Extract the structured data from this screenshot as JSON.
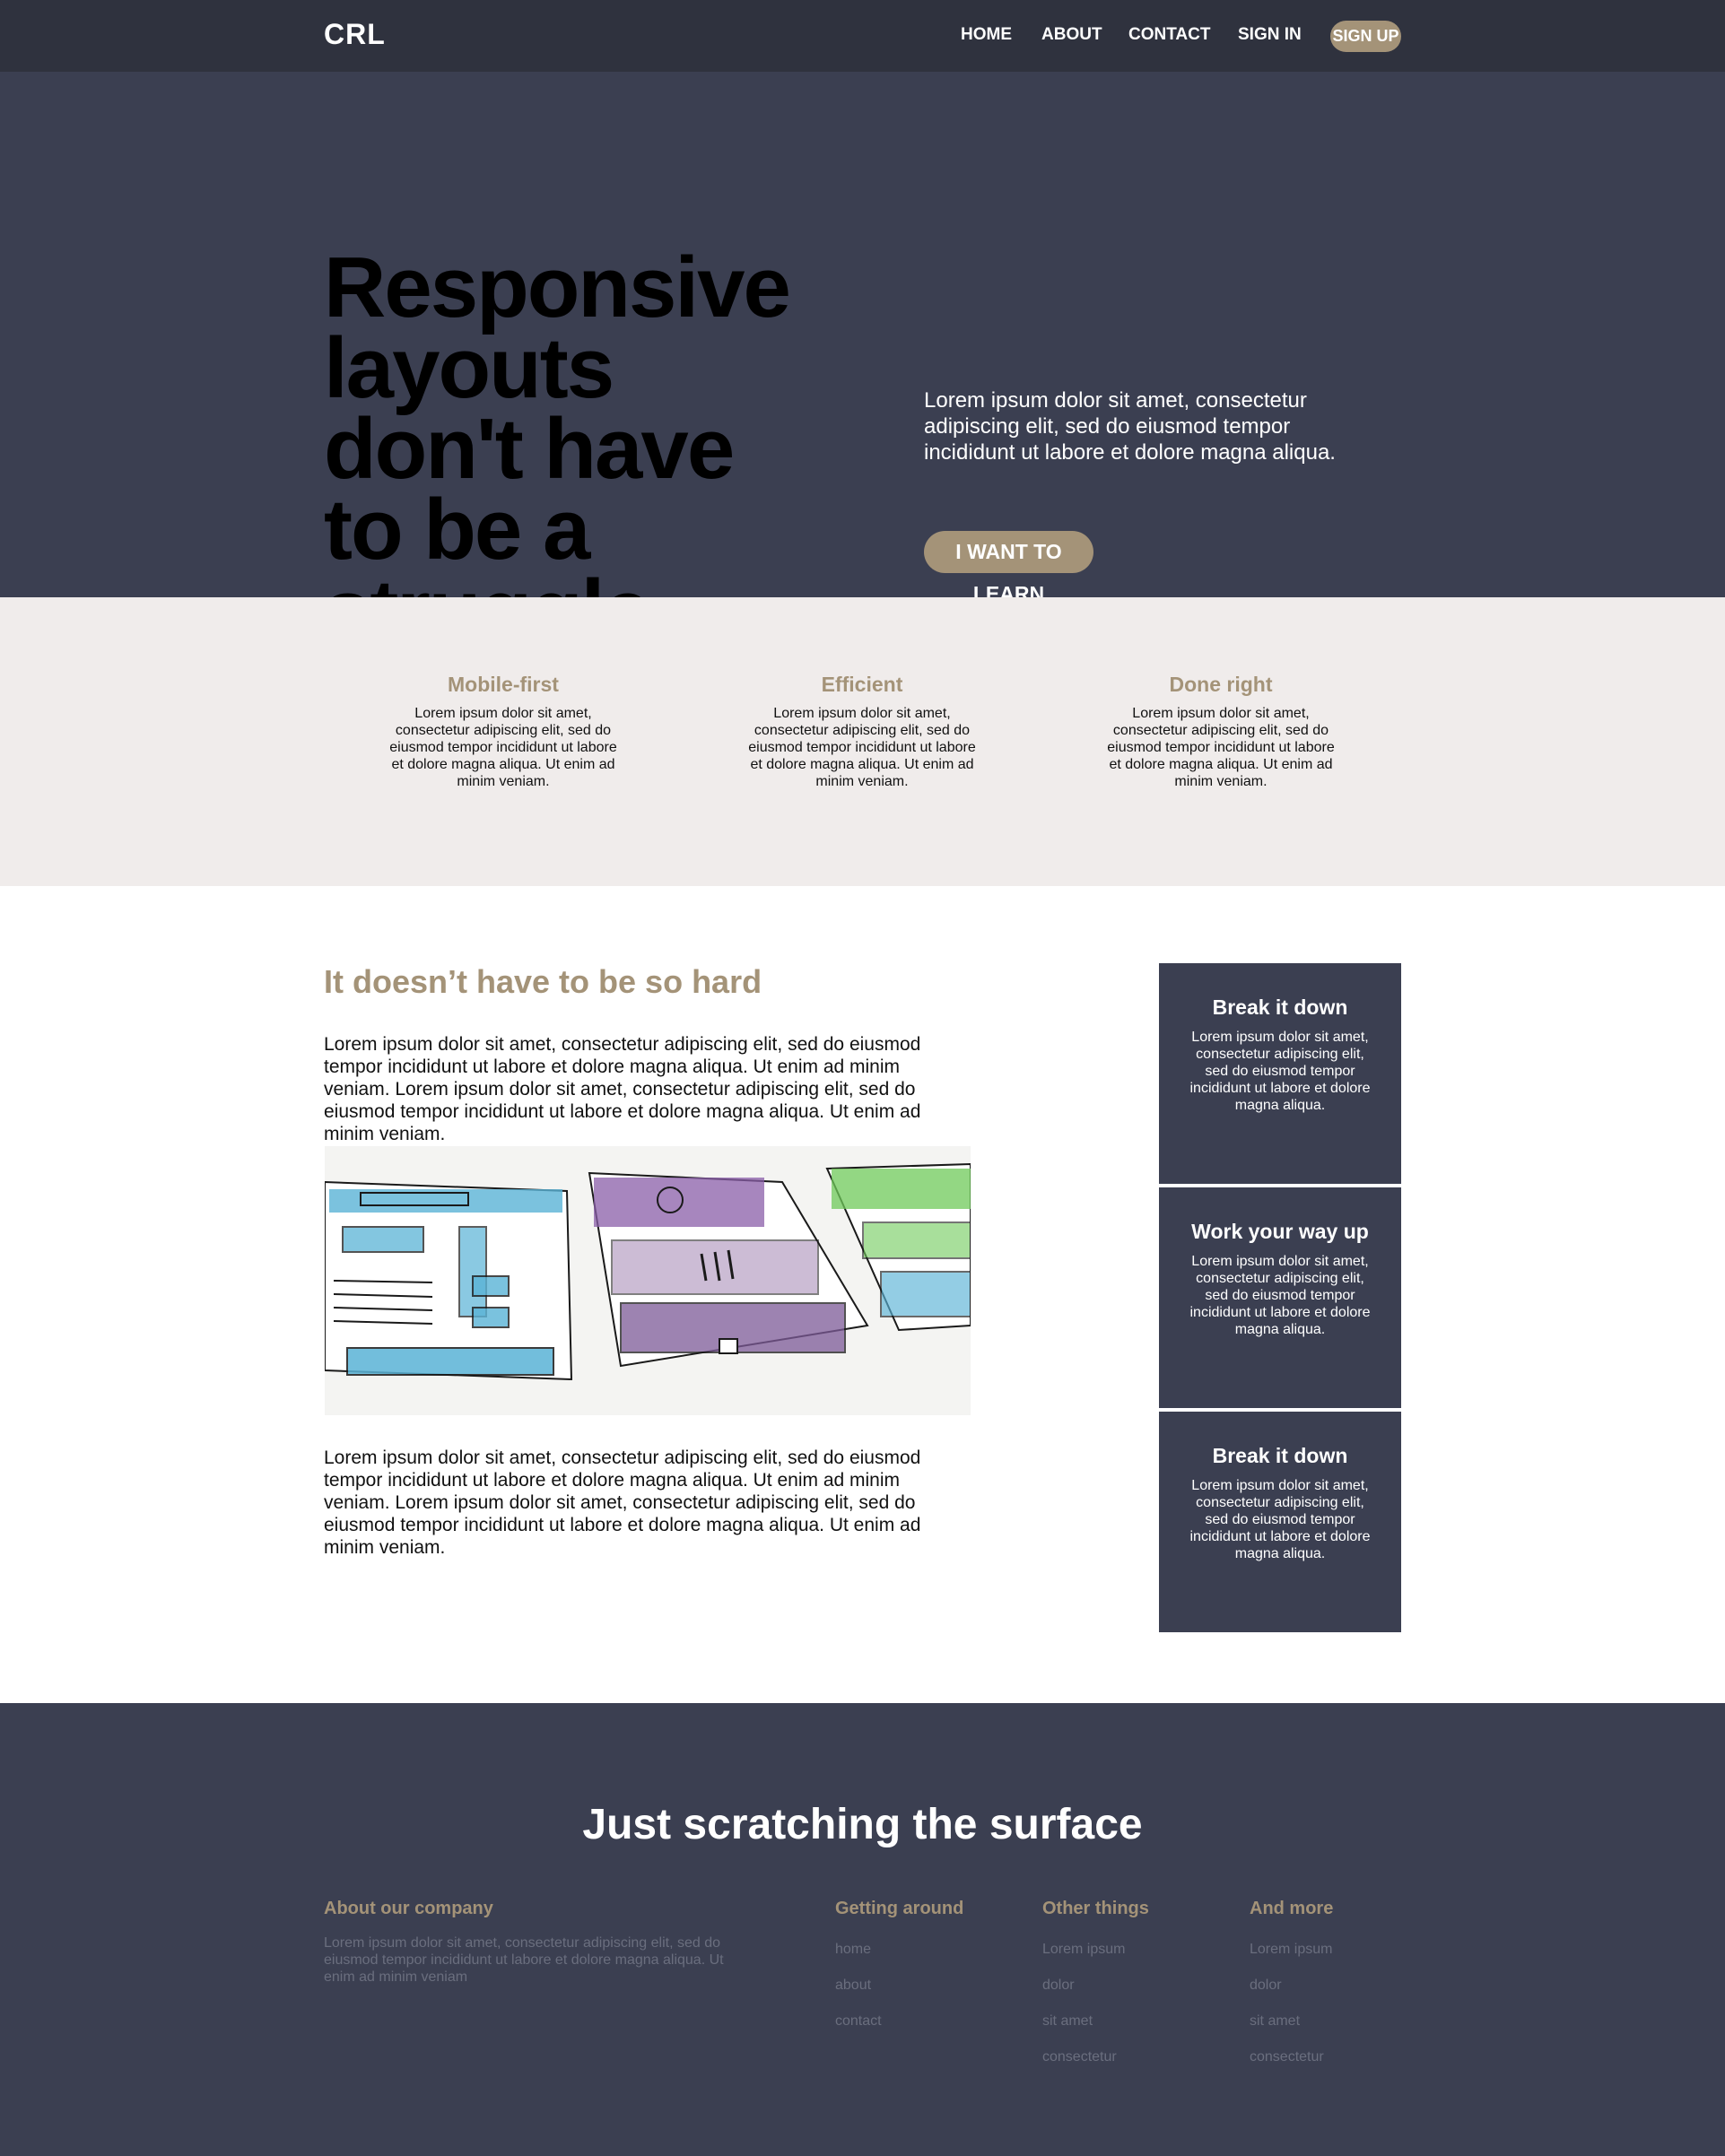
{
  "nav": {
    "logo": "CRL",
    "links": [
      "HOME",
      "ABOUT",
      "CONTACT",
      "SIGN IN"
    ],
    "signup": "SIGN UP"
  },
  "hero": {
    "title": "Responsive layouts don't have to be a struggle.",
    "text": "Lorem ipsum dolor sit amet, consectetur adipiscing elit, sed do eiusmod tempor incididunt ut labore et dolore magna aliqua.",
    "button": "I WANT TO LEARN"
  },
  "features": [
    {
      "title": "Mobile-first",
      "text": "Lorem ipsum dolor sit amet, consectetur adipiscing elit, sed do eiusmod tempor incididunt ut labore et dolore magna aliqua. Ut enim ad minim veniam."
    },
    {
      "title": "Efficient",
      "text": "Lorem ipsum dolor sit amet, consectetur adipiscing elit, sed do eiusmod tempor incididunt ut labore et dolore magna aliqua. Ut enim ad minim veniam."
    },
    {
      "title": "Done right",
      "text": "Lorem ipsum dolor sit amet, consectetur adipiscing elit, sed do eiusmod tempor incididunt ut labore et dolore magna aliqua. Ut enim ad minim veniam."
    }
  ],
  "main": {
    "title": "It doesn’t have to be so hard",
    "para1": "Lorem ipsum dolor sit amet, consectetur adipiscing elit, sed do eiusmod tempor incididunt ut labore et dolore magna aliqua. Ut enim ad minim veniam. Lorem ipsum dolor sit amet, consectetur adipiscing elit, sed do eiusmod tempor incididunt ut labore et dolore magna aliqua. Ut enim ad minim veniam.",
    "para2": "Lorem ipsum dolor sit amet, consectetur adipiscing elit, sed do eiusmod tempor incididunt ut labore et dolore magna aliqua. Ut enim ad minim veniam. Lorem ipsum dolor sit amet, consectetur adipiscing elit, sed do eiusmod tempor incididunt ut labore et dolore magna aliqua. Ut enim ad minim veniam."
  },
  "cards": [
    {
      "title": "Break it down",
      "text": "Lorem ipsum dolor sit amet, consectetur adipiscing elit, sed do eiusmod tempor incididunt ut labore et dolore magna aliqua."
    },
    {
      "title": "Work your way up",
      "text": "Lorem ipsum dolor sit amet, consectetur adipiscing elit, sed do eiusmod tempor incididunt ut labore et dolore magna aliqua."
    },
    {
      "title": "Break it down",
      "text": "Lorem ipsum dolor sit amet, consectetur adipiscing elit, sed do eiusmod tempor incididunt ut labore et dolore magna aliqua."
    }
  ],
  "footer": {
    "title": "Just scratching the surface",
    "about_title": "About our company",
    "about_text": "Lorem ipsum dolor sit amet, consectetur adipiscing elit, sed do eiusmod tempor incididunt ut labore et dolore magna aliqua. Ut enim ad minim veniam",
    "col1_title": "Getting around",
    "col1_links": [
      "home",
      "about",
      "contact"
    ],
    "col2_title": "Other things",
    "col2_links": [
      "Lorem ipsum",
      "dolor",
      "sit amet",
      "consectetur"
    ],
    "col3_title": "And more",
    "col3_links": [
      "Lorem ipsum",
      "dolor",
      "sit amet",
      "consectetur"
    ]
  },
  "colors": {
    "nav_bg": "#2f323e",
    "dark": "#3b3f51",
    "accent": "#a49378",
    "light_bg": "#f0eceb"
  }
}
